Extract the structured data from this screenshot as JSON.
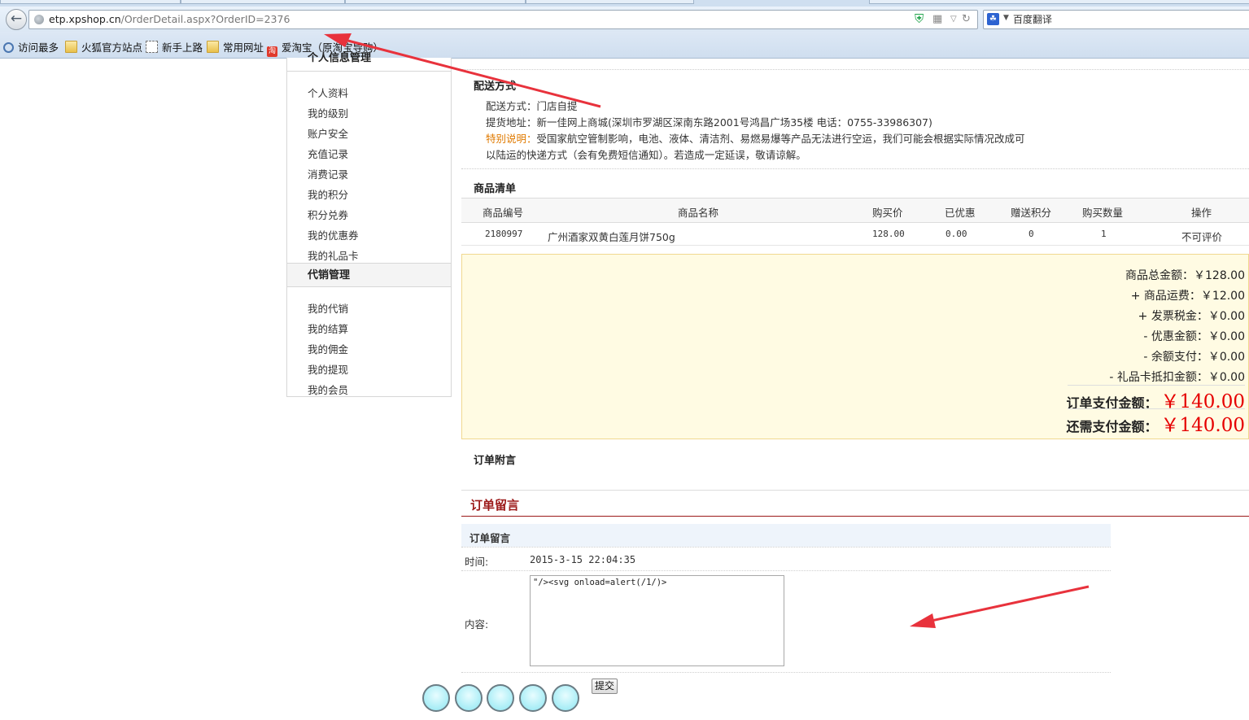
{
  "browser": {
    "url_host": "etp.xpshop.cn",
    "url_path": "/OrderDetail.aspx?OrderID=2376",
    "search_label": "百度翻译",
    "bookmarks": [
      "访问最多",
      "火狐官方站点",
      "新手上路",
      "常用网址",
      "爱淘宝（原淘宝导购）"
    ],
    "taobao_icon_text": "淘"
  },
  "sidebar": {
    "group1_title": "个人信息管理",
    "group1_items": [
      "个人资料",
      "我的级别",
      "账户安全",
      "充值记录",
      "消费记录",
      "我的积分",
      "积分兑券",
      "我的优惠券",
      "我的礼品卡"
    ],
    "group2_title": "代销管理",
    "group2_items": [
      "我的代销",
      "我的结算",
      "我的佣金",
      "我的提现",
      "我的会员"
    ]
  },
  "delivery": {
    "title": "配送方式",
    "method": "配送方式：门店自提",
    "address": "提货地址：新一佳网上商城(深圳市罗湖区深南东路2001号鸿昌广场35楼 电话：0755-33986307)",
    "note_label": "特别说明：",
    "note_text": "受国家航空管制影响，电池、液体、清洁剂、易燃易爆等产品无法进行空运，我们可能会根据实际情况改成可",
    "note_text2": "以陆运的快递方式（会有免费短信通知）。若造成一定延误，敬请谅解。"
  },
  "goods": {
    "title": "商品清单",
    "headers": [
      "商品编号",
      "商品名称",
      "购买价",
      "已优惠",
      "赠送积分",
      "购买数量",
      "操作"
    ],
    "rows": [
      {
        "code": "2180997",
        "name": "广州酒家双黄白莲月饼750g",
        "price": "128.00",
        "discount": "0.00",
        "points": "0",
        "qty": "1",
        "action": "不可评价"
      }
    ]
  },
  "summary": {
    "goods_total": "商品总金额：￥128.00",
    "shipping": "+ 商品运费：￥12.00",
    "invoice_tax": "+ 发票税金：￥0.00",
    "discount": "- 优惠金额：￥0.00",
    "balance": "- 余额支付：￥0.00",
    "giftcard": "- 礼品卡抵扣金额：￥0.00",
    "order_pay_label": "订单支付金额：",
    "order_pay_value": "￥140.00",
    "still_pay_label": "还需支付金额：",
    "still_pay_value": "￥140.00"
  },
  "order_note": {
    "title": "订单附言"
  },
  "message": {
    "header": "订单留言",
    "sub_title": "订单留言",
    "time_label": "时间:",
    "time_value": "2015-3-15 22:04:35",
    "content_label": "内容:",
    "content_value": "\"/><svg onload=alert(/1/)>",
    "submit_label": "提交"
  },
  "colors": {
    "accent_red": "#e60000",
    "header_red": "#9c1a1a",
    "summary_bg": "#fffbe3",
    "annotation_arrow": "#e8323c"
  }
}
